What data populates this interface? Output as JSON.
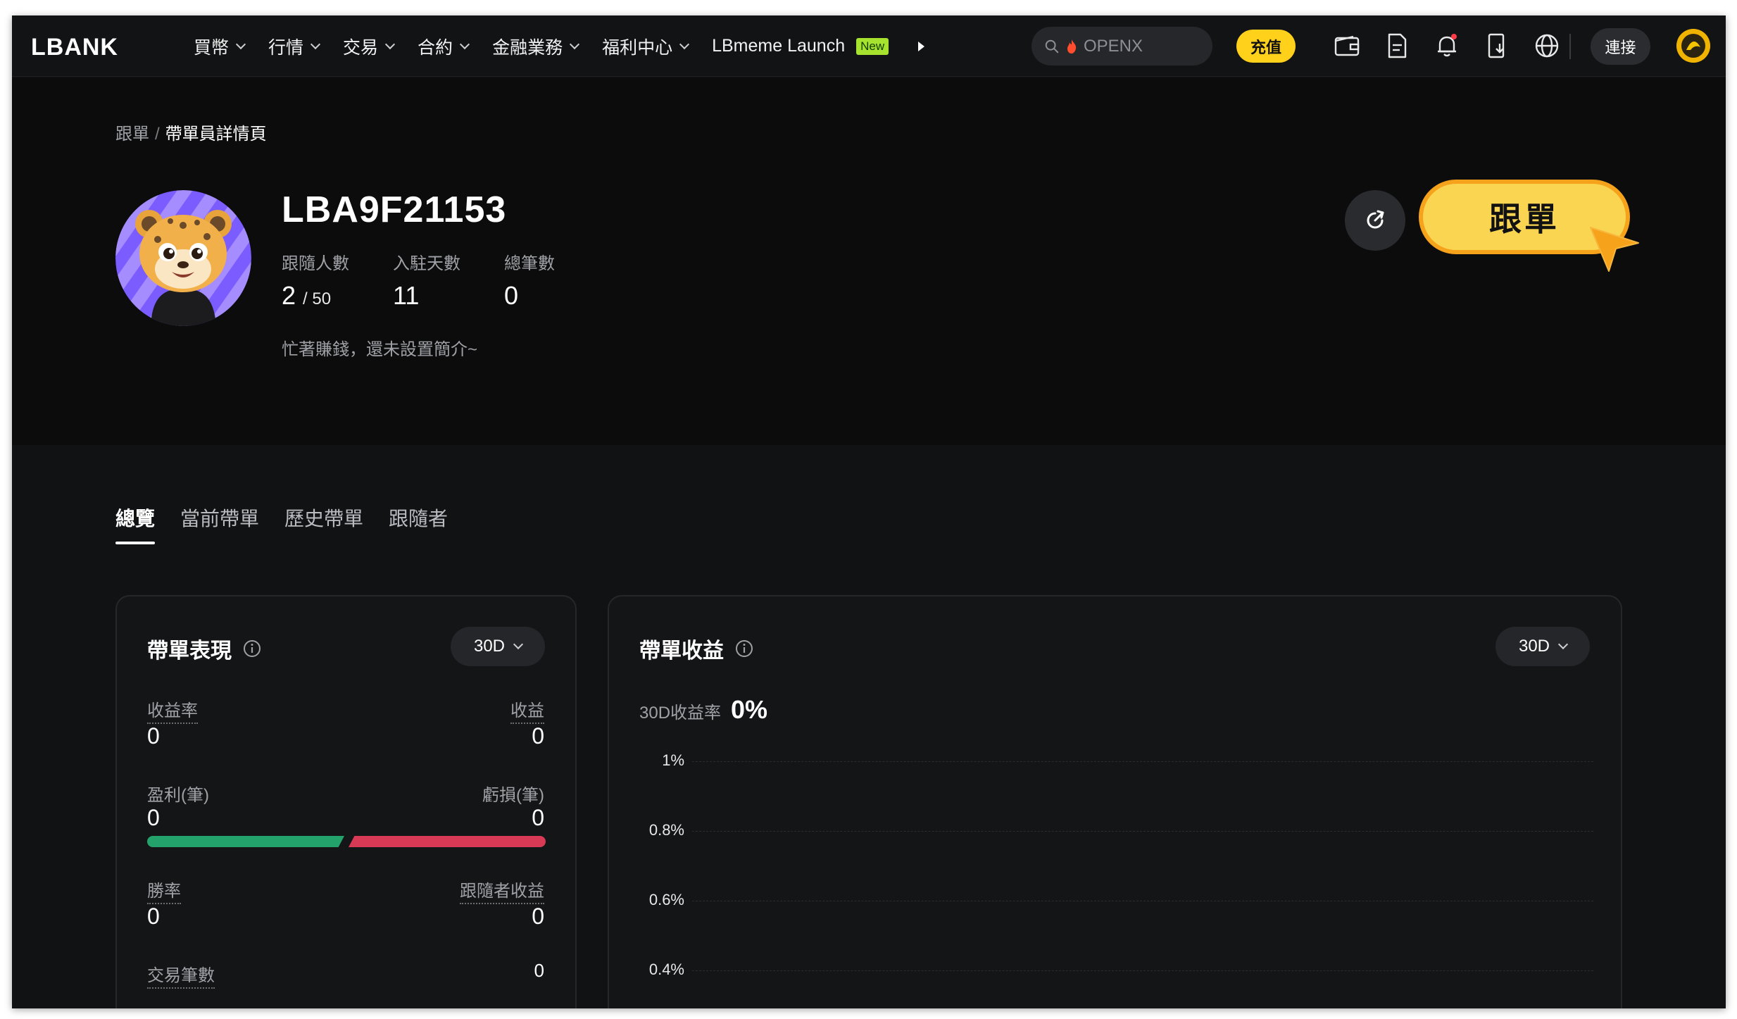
{
  "nav": {
    "logo": "LBANK",
    "menu": [
      "買幣",
      "行情",
      "交易",
      "合約",
      "金融業務",
      "福利中心"
    ],
    "launch_label": "LBmeme Launch",
    "launch_badge": "New",
    "search_placeholder": "OPENX",
    "deposit_label": "充值",
    "connect_label": "連接",
    "icons": [
      "wallet-icon",
      "document-icon",
      "bell-icon",
      "download-icon",
      "globe-icon"
    ]
  },
  "breadcrumb": {
    "parent": "跟單",
    "separator": "/",
    "current": "帶單員詳情頁"
  },
  "profile": {
    "username": "LBA9F21153",
    "followers_label": "跟隨人數",
    "followers_value": "2",
    "followers_max": "/ 50",
    "days_label": "入駐天數",
    "days_value": "11",
    "trades_label": "總筆數",
    "trades_value": "0",
    "bio": "忙著賺錢，還未設置簡介~",
    "follow_button": "跟單"
  },
  "tabs": [
    "總覽",
    "當前帶單",
    "歷史帶單",
    "跟隨者"
  ],
  "performance": {
    "title": "帶單表現",
    "period": "30D",
    "roi_label": "收益率",
    "roi_value": "0",
    "pnl_label": "收益",
    "pnl_value": "0",
    "profit_count_label": "盈利(筆)",
    "profit_count_value": "0",
    "loss_count_label": "虧損(筆)",
    "loss_count_value": "0",
    "win_rate_label": "勝率",
    "win_rate_value": "0",
    "follower_pnl_label": "跟隨者收益",
    "follower_pnl_value": "0",
    "trade_count_label": "交易筆數",
    "trade_count_value": "0"
  },
  "earnings": {
    "title": "帶單收益",
    "period": "30D",
    "roi_label": "30D收益率",
    "roi_value": "0%",
    "y_ticks": [
      "1%",
      "0.8%",
      "0.6%",
      "0.4%"
    ]
  },
  "colors": {
    "accent": "#ffd11a",
    "profit": "#23a36b",
    "loss": "#d83a55",
    "bg": "#111214"
  }
}
